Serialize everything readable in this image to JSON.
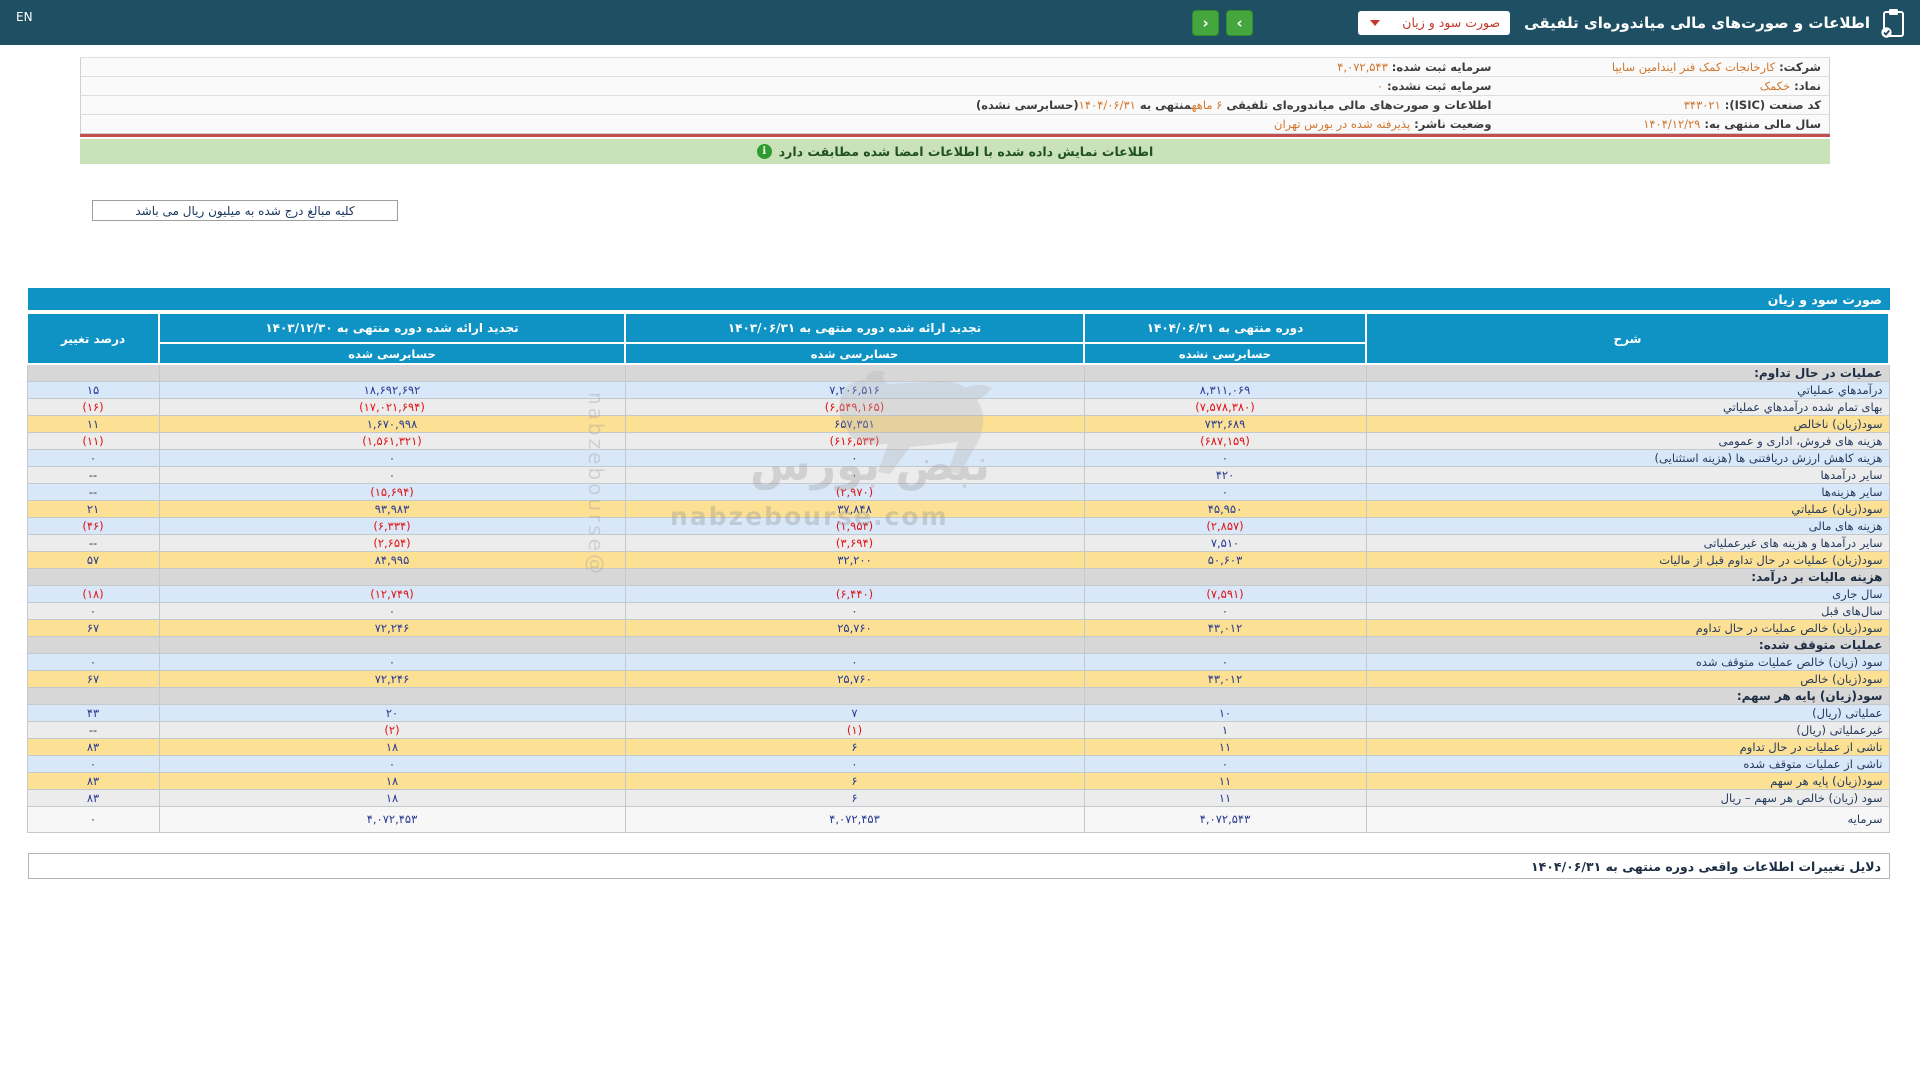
{
  "header": {
    "en_label": "EN",
    "title": "اطلاعات و صورت‌های مالی میاندوره‌ای تلفیقی",
    "dropdown_value": "صورت سود و زیان",
    "prev_icon": "‹",
    "next_icon": "›"
  },
  "company_info": {
    "rows": [
      {
        "right": [
          {
            "t": "شرکت:  ",
            "k": "label"
          },
          {
            "t": "کارخانجات کمک فنر ایندامین سایپا",
            "k": "value"
          }
        ],
        "left": [
          {
            "t": "سرمایه ثبت شده:  ",
            "k": "label"
          },
          {
            "t": "۴,۰۷۲,۵۴۳",
            "k": "value"
          }
        ]
      },
      {
        "right": [
          {
            "t": "نماد:  ",
            "k": "label"
          },
          {
            "t": "خکمک",
            "k": "value"
          }
        ],
        "left": [
          {
            "t": "سرمایه ثبت نشده:  ",
            "k": "label"
          },
          {
            "t": "۰",
            "k": "value"
          }
        ]
      },
      {
        "right": [
          {
            "t": "کد صنعت (ISIC):  ",
            "k": "label"
          },
          {
            "t": "۳۴۳۰۲۱",
            "k": "value"
          }
        ],
        "left": [
          {
            "t": "اطلاعات و صورت‌های مالی میاندوره‌ای تلفیقی ",
            "k": "label"
          },
          {
            "t": "۶ ماهه",
            "k": "value"
          },
          {
            "t": "منتهی به ",
            "k": "label"
          },
          {
            "t": "۱۴۰۴/۰۶/۳۱",
            "k": "value"
          },
          {
            "t": "(حسابرسی نشده)",
            "k": "label"
          }
        ]
      },
      {
        "right": [
          {
            "t": "سال مالی منتهی به:  ",
            "k": "label"
          },
          {
            "t": "۱۴۰۴/۱۲/۲۹",
            "k": "value"
          }
        ],
        "left": [
          {
            "t": "وضعیت ناشر:  ",
            "k": "label"
          },
          {
            "t": "پذیرفته شده در بورس تهران",
            "k": "value"
          }
        ]
      }
    ]
  },
  "banner": {
    "icon": "i",
    "text": "اطلاعات نمایش داده شده با اطلاعات امضا شده مطابقت دارد"
  },
  "note_box": {
    "text": "کلیه مبالغ درج شده به میلیون ریال می باشد"
  },
  "statement_table": {
    "title": "صورت سود و زیان",
    "columns": {
      "desc": "شرح",
      "current": {
        "title": "دوره منتهی به ۱۴۰۴/۰۶/۳۱",
        "sub": "حسابرسی نشده"
      },
      "prior": {
        "title": "تجدید ارائه شده دوره منتهی به ۱۴۰۳/۰۶/۳۱",
        "sub": "حسابرسی شده"
      },
      "annual": {
        "title": "تجدید ارائه شده دوره منتهی به ۱۴۰۳/۱۲/۳۰",
        "sub": "حسابرسی شده"
      },
      "change": "درصد تغییر"
    },
    "rows": [
      {
        "type": "section",
        "label": "عملیات در حال تداوم:"
      },
      {
        "type": "data",
        "bg": "blue",
        "label": "درآمدهاي عملياتي",
        "current": "۸,۳۱۱,۰۶۹",
        "prior": "۷,۲۰۶,۵۱۶",
        "annual": "۱۸,۶۹۲,۶۹۲",
        "change": "۱۵"
      },
      {
        "type": "data",
        "bg": "gray",
        "label": "بهای تمام شده درآمدهاي عملياتي",
        "current": "(۷,۵۷۸,۳۸۰)",
        "prior": "(۶,۵۴۹,۱۶۵)",
        "annual": "(۱۷,۰۲۱,۶۹۴)",
        "change": "(۱۶)"
      },
      {
        "type": "data",
        "bg": "yellow",
        "label": "سود(زيان) ناخالص",
        "current": "۷۳۲,۶۸۹",
        "prior": "۶۵۷,۳۵۱",
        "annual": "۱,۶۷۰,۹۹۸",
        "change": "۱۱"
      },
      {
        "type": "data",
        "bg": "gray",
        "label": "هزینه های فروش، اداری و عمومی",
        "current": "(۶۸۷,۱۵۹)",
        "prior": "(۶۱۶,۵۳۳)",
        "annual": "(۱,۵۶۱,۳۲۱)",
        "change": "(۱۱)"
      },
      {
        "type": "data",
        "bg": "blue",
        "label": "هزینه کاهش ارزش دریافتنی ها (هزینه استثنایی)",
        "current": "۰",
        "prior": "۰",
        "annual": "۰",
        "change": "۰"
      },
      {
        "type": "data",
        "bg": "gray",
        "label": "سایر درآمدها",
        "current": "۴۲۰",
        "prior": "۰",
        "annual": "۰",
        "change": "--"
      },
      {
        "type": "data",
        "bg": "blue",
        "label": "سایر هزینه‌ها",
        "current": "۰",
        "prior": "(۲,۹۷۰)",
        "annual": "(۱۵,۶۹۴)",
        "change": "--"
      },
      {
        "type": "data",
        "bg": "yellow",
        "label": "سود(زيان) عملياتي",
        "current": "۴۵,۹۵۰",
        "prior": "۳۷,۸۴۸",
        "annual": "۹۳,۹۸۳",
        "change": "۲۱"
      },
      {
        "type": "data",
        "bg": "blue",
        "label": "هزینه های مالی",
        "current": "(۲,۸۵۷)",
        "prior": "(۱,۹۵۴)",
        "annual": "(۶,۳۳۴)",
        "change": "(۴۶)"
      },
      {
        "type": "data",
        "bg": "gray",
        "label": "سایر درآمدها و هزینه های غیرعملیاتی",
        "current": "۷,۵۱۰",
        "prior": "(۳,۶۹۴)",
        "annual": "(۲,۶۵۴)",
        "change": "--"
      },
      {
        "type": "data",
        "bg": "yellow",
        "label": "سود(زیان) عملیات در حال تداوم قبل از مالیات",
        "current": "۵۰,۶۰۳",
        "prior": "۳۲,۲۰۰",
        "annual": "۸۴,۹۹۵",
        "change": "۵۷"
      },
      {
        "type": "section",
        "label": "هزینه مالیات بر درآمد:"
      },
      {
        "type": "data",
        "bg": "blue",
        "label": "سال جاری",
        "current": "(۷,۵۹۱)",
        "prior": "(۶,۴۴۰)",
        "annual": "(۱۲,۷۴۹)",
        "change": "(۱۸)"
      },
      {
        "type": "data",
        "bg": "gray",
        "label": "سال‌های قبل",
        "current": "۰",
        "prior": "۰",
        "annual": "۰",
        "change": "۰"
      },
      {
        "type": "data",
        "bg": "yellow",
        "label": "سود(زیان) خالص عملیات در حال تداوم",
        "current": "۴۳,۰۱۲",
        "prior": "۲۵,۷۶۰",
        "annual": "۷۲,۲۴۶",
        "change": "۶۷"
      },
      {
        "type": "section",
        "label": "عملیات متوقف شده:"
      },
      {
        "type": "data",
        "bg": "blue",
        "label": "سود (زیان) خالص عملیات متوقف شده",
        "current": "۰",
        "prior": "۰",
        "annual": "۰",
        "change": "۰"
      },
      {
        "type": "data",
        "bg": "yellow",
        "label": "سود(زیان) خالص",
        "current": "۴۳,۰۱۲",
        "prior": "۲۵,۷۶۰",
        "annual": "۷۲,۲۴۶",
        "change": "۶۷"
      },
      {
        "type": "section",
        "label": "سود(زیان) پایه هر سهم:"
      },
      {
        "type": "data",
        "bg": "blue",
        "label": "عملیاتی (ریال)",
        "current": "۱۰",
        "prior": "۷",
        "annual": "۲۰",
        "change": "۴۳"
      },
      {
        "type": "data",
        "bg": "gray",
        "label": "غیرعملیاتی (ریال)",
        "current": "۱",
        "prior": "(۱)",
        "annual": "(۲)",
        "change": "--"
      },
      {
        "type": "data",
        "bg": "yellow",
        "label": "ناشی از عملیات در حال تداوم",
        "current": "۱۱",
        "prior": "۶",
        "annual": "۱۸",
        "change": "۸۳"
      },
      {
        "type": "data",
        "bg": "blue",
        "label": "ناشی از عملیات متوقف شده",
        "current": "۰",
        "prior": "۰",
        "annual": "۰",
        "change": "۰"
      },
      {
        "type": "data",
        "bg": "yellow",
        "label": "سود(زیان) پایه هر سهم",
        "current": "۱۱",
        "prior": "۶",
        "annual": "۱۸",
        "change": "۸۳"
      },
      {
        "type": "data",
        "bg": "gray",
        "label": "سود (زیان) خالص هر سهم – ریال",
        "current": "۱۱",
        "prior": "۶",
        "annual": "۱۸",
        "change": "۸۳"
      },
      {
        "type": "data",
        "bg": "white",
        "tall": true,
        "label": "سرمایه",
        "current": "۴,۰۷۲,۵۴۳",
        "prior": "۴,۰۷۲,۴۵۳",
        "annual": "۴,۰۷۲,۴۵۳",
        "change": "۰"
      }
    ]
  },
  "footer_bar": {
    "text": "دلایل تغییرات اطلاعات واقعی دوره منتهی به ۱۴۰۴/۰۶/۳۱"
  },
  "watermark": {
    "brand_fa": "نبض بورس",
    "site": "nabzebourse.com",
    "handle": "@nabzebourse"
  },
  "colors": {
    "topbar_bg": "#1f4f63",
    "table_header_blue": "#0f93c5",
    "row_highlight_yellow": "#fce094",
    "row_alt_blue": "#d9e8f8",
    "row_alt_gray": "#ececec",
    "section_row_gray": "#d7d7d7",
    "positive_number": "#273a93",
    "negative_number": "#e01414",
    "info_value_orange": "#d0762d",
    "banner_green_bg": "#c9e2b8",
    "red_divider": "#c0504d",
    "nav_button_green": "#45a63d",
    "dropdown_text_red": "#c0392b"
  }
}
